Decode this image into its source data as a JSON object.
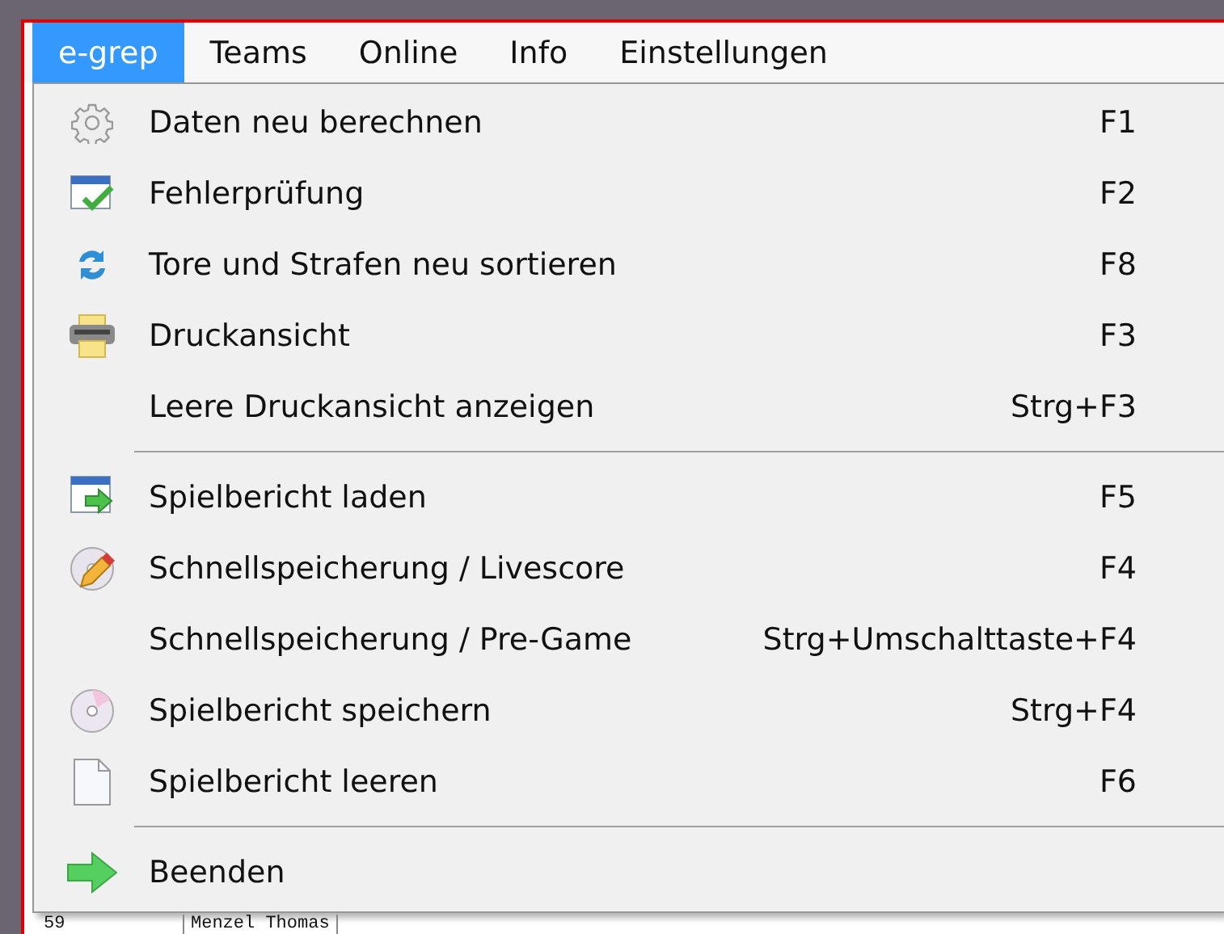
{
  "menubar": [
    {
      "label": "e-grep",
      "selected": true
    },
    {
      "label": "Teams",
      "selected": false
    },
    {
      "label": "Online",
      "selected": false
    },
    {
      "label": "Info",
      "selected": false
    },
    {
      "label": "Einstellungen",
      "selected": false
    }
  ],
  "menu": [
    {
      "kind": "item",
      "label": "Daten neu berechnen",
      "shortcut": "F1"
    },
    {
      "kind": "item",
      "label": "Fehlerprüfung",
      "shortcut": "F2"
    },
    {
      "kind": "item",
      "label": "Tore und Strafen neu sortieren",
      "shortcut": "F8"
    },
    {
      "kind": "item",
      "label": "Druckansicht",
      "shortcut": "F3"
    },
    {
      "kind": "item",
      "label": "Leere Druckansicht anzeigen",
      "shortcut": "Strg+F3"
    },
    {
      "kind": "separator"
    },
    {
      "kind": "item",
      "label": "Spielbericht laden",
      "shortcut": "F5"
    },
    {
      "kind": "item",
      "label": "Schnellspeicherung / Livescore",
      "shortcut": "F4"
    },
    {
      "kind": "item",
      "label": "Schnellspeicherung / Pre-Game",
      "shortcut": "Strg+Umschalttaste+F4"
    },
    {
      "kind": "item",
      "label": "Spielbericht speichern",
      "shortcut": "Strg+F4"
    },
    {
      "kind": "item",
      "label": "Spielbericht leeren",
      "shortcut": "F6"
    },
    {
      "kind": "separator"
    },
    {
      "kind": "item",
      "label": "Beenden"
    }
  ],
  "table_row": [
    "59",
    "Menzel Thomas"
  ]
}
